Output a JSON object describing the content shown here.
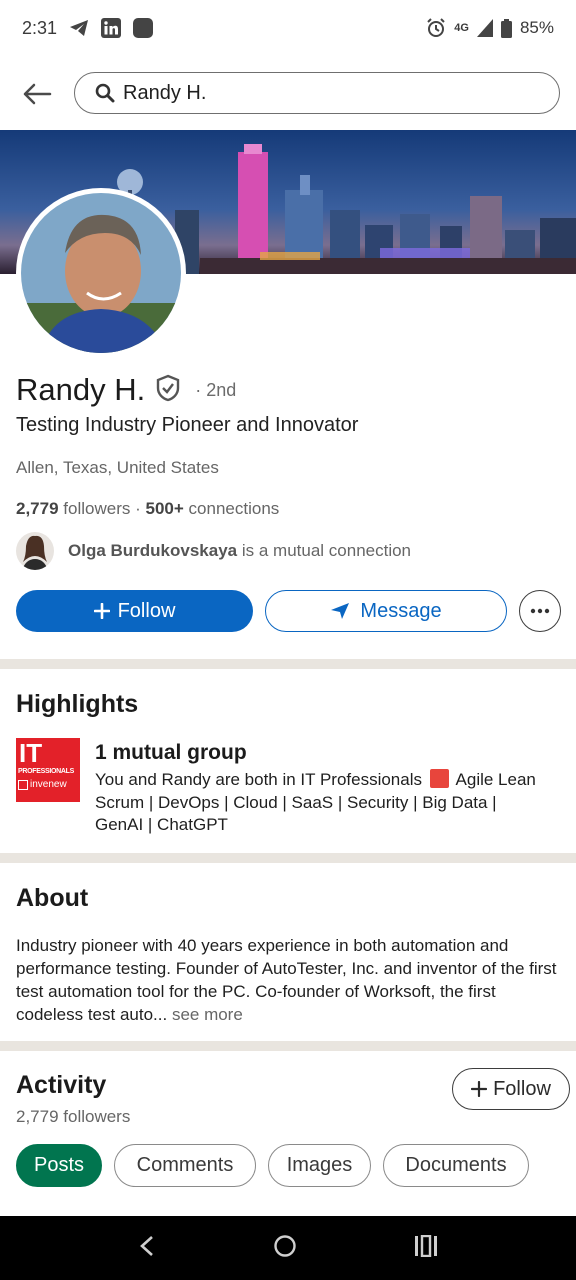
{
  "status_bar": {
    "time": "2:31",
    "network": "4G",
    "battery": "85%",
    "icons_left": [
      "telegram-icon",
      "linkedin-icon",
      "app-icon"
    ],
    "icons_right": [
      "alarm-icon",
      "signal-icon",
      "battery-icon"
    ]
  },
  "search": {
    "value": "Randy H."
  },
  "profile": {
    "name": "Randy H.",
    "degree": "· 2nd",
    "headline": "Testing Industry Pioneer and Innovator",
    "location": "Allen, Texas, United States",
    "followers_count": "2,779",
    "followers_label": "followers",
    "separator": "·",
    "connections_count": "500+",
    "connections_label": "connections",
    "mutual_name": "Olga Burdukovskaya",
    "mutual_suffix": "is a mutual connection"
  },
  "actions": {
    "follow_label": "Follow",
    "message_label": "Message"
  },
  "highlights": {
    "title": "Highlights",
    "logo_big": "IT",
    "logo_small": "PROFESSIONALS",
    "logo_brand": "invenew",
    "group_title": "1 mutual group",
    "group_text_before": "You and Randy are both in IT Professionals",
    "group_text_after": "Agile Lean Scrum | DevOps | Cloud | SaaS | Security | Big Data | GenAI | ChatGPT"
  },
  "about": {
    "title": "About",
    "text": "Industry pioneer with 40 years experience in both automation and performance testing.  Founder of AutoTester, Inc. and inventor of the first test automation tool for the PC. Co-founder of Worksoft, the first codeless test auto...",
    "see_more": "see more"
  },
  "activity": {
    "title": "Activity",
    "followers": "2,779 followers",
    "follow_label": "Follow",
    "tabs": [
      "Posts",
      "Comments",
      "Images",
      "Documents"
    ],
    "active_tab": "Posts"
  },
  "colors": {
    "primary": "#0a66c2",
    "active_pill": "#01754f",
    "divider": "#e9e5df",
    "it_red": "#e32129"
  }
}
